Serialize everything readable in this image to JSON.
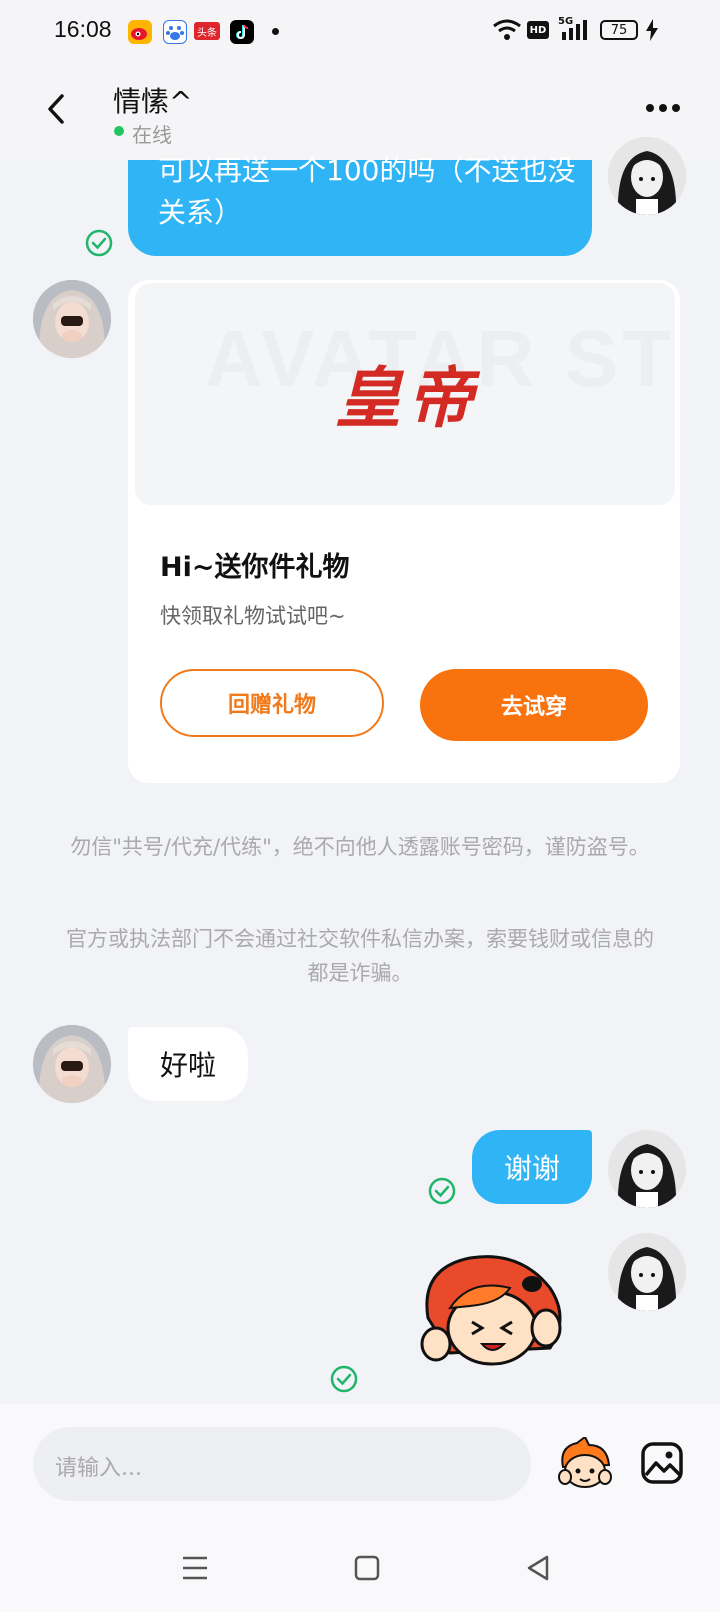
{
  "status_bar": {
    "time": "16:08",
    "battery": "75",
    "network": "5G",
    "hd_badge": "HD",
    "app_badge": "头条"
  },
  "header": {
    "title": "情愫^",
    "status": "在线"
  },
  "messages": {
    "m1": "可以再送一个100的吗（不送也没关系）",
    "gift_logo": "皇帝",
    "gift_watermark": "AVATAR STORE",
    "gift_title": "Hi~送你件礼物",
    "gift_subtitle": "快领取礼物试试吧~",
    "gift_return_button": "回赠礼物",
    "gift_try_button": "去试穿",
    "notice1": "勿信\"共号/代充/代练\"，绝不向他人透露账号密码，谨防盗号。",
    "notice2": "官方或执法部门不会通过社交软件私信办案，索要钱财或信息的都是诈骗。",
    "m2": "好啦",
    "m3": "谢谢"
  },
  "input": {
    "placeholder": "请输入..."
  },
  "colors": {
    "bubble_blue": "#2fb4f6",
    "accent_orange": "#f8730e",
    "online_green": "#22c45e"
  }
}
